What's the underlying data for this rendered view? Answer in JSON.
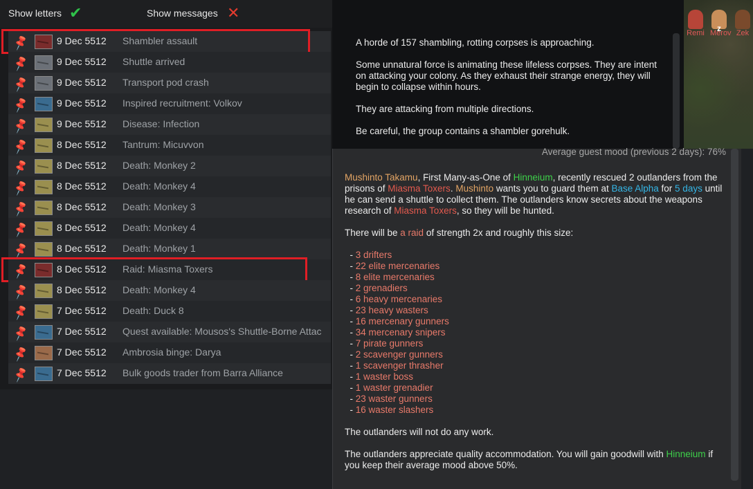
{
  "header": {
    "show_letters_label": "Show letters",
    "show_letters_state": "on",
    "show_messages_label": "Show messages",
    "show_messages_state": "off",
    "check_glyph": "✔",
    "cross_glyph": "✕"
  },
  "colonists": [
    {
      "name": "Remi",
      "color": "#b74538"
    },
    {
      "name": "Merov",
      "color": "#c98f5a",
      "sleeping": "z"
    },
    {
      "name": "Zek",
      "color": "#7a4a2c"
    }
  ],
  "letters": [
    {
      "date": "9 Dec 5512",
      "title": "Shambler assault",
      "color": "#7a2c2c",
      "highlighted": true
    },
    {
      "date": "9 Dec 5512",
      "title": "Shuttle arrived",
      "color": "#6b7077"
    },
    {
      "date": "9 Dec 5512",
      "title": "Transport pod crash",
      "color": "#6b7077"
    },
    {
      "date": "9 Dec 5512",
      "title": "Inspired recruitment: Volkov",
      "color": "#3a6b8f"
    },
    {
      "date": "9 Dec 5512",
      "title": "Disease: Infection",
      "color": "#9a8f4f"
    },
    {
      "date": "8 Dec 5512",
      "title": "Tantrum: Micuvvon",
      "color": "#9a8f4f"
    },
    {
      "date": "8 Dec 5512",
      "title": "Death: Monkey 2",
      "color": "#9a8f4f"
    },
    {
      "date": "8 Dec 5512",
      "title": "Death: Monkey 4",
      "color": "#9a8f4f"
    },
    {
      "date": "8 Dec 5512",
      "title": "Death: Monkey 3",
      "color": "#9a8f4f"
    },
    {
      "date": "8 Dec 5512",
      "title": "Death: Monkey 4",
      "color": "#9a8f4f"
    },
    {
      "date": "8 Dec 5512",
      "title": "Death: Monkey 1",
      "color": "#9a8f4f"
    },
    {
      "date": "8 Dec 5512",
      "title": "Raid: Miasma Toxers",
      "color": "#7a2c2c",
      "highlighted": true
    },
    {
      "date": "8 Dec 5512",
      "title": "Death: Monkey 4",
      "color": "#9a8f4f"
    },
    {
      "date": "7 Dec 5512",
      "title": "Death: Duck 8",
      "color": "#9a8f4f"
    },
    {
      "date": "7 Dec 5512",
      "title": "Quest available: Mousos's Shuttle-Borne Attac",
      "color": "#3a6b8f"
    },
    {
      "date": "7 Dec 5512",
      "title": "Ambrosia binge: Darya",
      "color": "#9a6a4a"
    },
    {
      "date": "7 Dec 5512",
      "title": "Bulk goods trader from Barra Alliance",
      "color": "#3a6b8f"
    }
  ],
  "description": {
    "p1": "A horde of 157 shambling, rotting corpses is approaching.",
    "p2": "Some unnatural force is animating these lifeless corpses. They are intent on attacking your colony. As they exhaust their strange energy, they will begin to collapse within hours.",
    "p3": "They are attacking from multiple directions.",
    "p4": "Be careful, the group contains a shambler gorehulk."
  },
  "quest": {
    "mood_line": "Average guest mood (previous 2 days): 76%",
    "giver": "Mushinto Takamu",
    "t1": ", First Many-as-One of ",
    "faction": "Hinneium",
    "t2": ", recently rescued 2 outlanders from the prisons of ",
    "enemy": "Miasma Toxers",
    "t3": ". ",
    "giver_short": "Mushinto",
    "t4": " wants you to guard them at ",
    "base": "Base Alpha",
    "t5": " for ",
    "days": "5 days",
    "t6": " until he can send a shuttle to collect them. The outlanders know secrets about the weapons research of ",
    "t7": ", so they will be hunted.",
    "raid_pre": "There will be ",
    "raid_word": "a raid",
    "raid_post": " of strength 2x and roughly this size:",
    "raid_list": [
      "3 drifters",
      "22 elite mercenaries",
      "8 elite mercenaries",
      "2 grenadiers",
      "6 heavy mercenaries",
      "23 heavy wasters",
      "16 mercenary gunners",
      "34 mercenary snipers",
      "7 pirate gunners",
      "2 scavenger gunners",
      "1 scavenger thrasher",
      "1 waster boss",
      "1 waster grenadier",
      "23 waster gunners",
      "16 waster slashers"
    ],
    "no_work": "The outlanders will not do any work.",
    "goodwill_pre": "The outlanders appreciate quality accommodation. You will gain goodwill with ",
    "goodwill_post": " if you keep their average mood above 50%."
  }
}
